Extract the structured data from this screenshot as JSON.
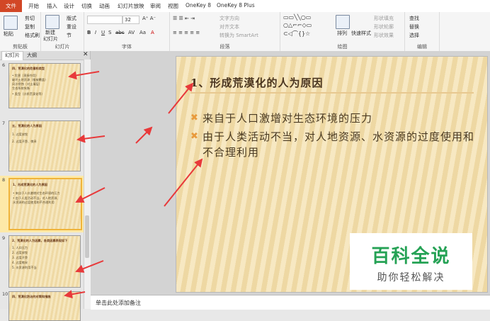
{
  "ribbon_tabs": [
    "文件",
    "开始",
    "插入",
    "设计",
    "切换",
    "动画",
    "幻灯片放映",
    "审阅",
    "视图",
    "OneKey 8",
    "OneKey 8 Plus"
  ],
  "clipboard": {
    "paste": "粘贴",
    "cut": "剪切",
    "copy": "复制",
    "format_painter": "格式刷",
    "label": "剪贴板"
  },
  "slides_group": {
    "new_slide": "新建",
    "new_slide2": "幻灯片",
    "layout": "版式",
    "reset": "重设",
    "section": "节",
    "label": "幻灯片"
  },
  "font_group": {
    "size": "32",
    "label": "字体"
  },
  "paragraph_group": {
    "text_direction": "文字方向",
    "align_text": "对齐文本",
    "convert_smartart": "转换为 SmartArt",
    "label": "段落"
  },
  "drawing_group": {
    "arrange": "排列",
    "quick_styles": "快速样式",
    "shape_fill": "形状填充",
    "shape_outline": "形状轮廓",
    "shape_effects": "形状效果",
    "label": "绘图"
  },
  "editing_group": {
    "find": "查找",
    "replace": "替换",
    "select": "选择",
    "label": "编辑"
  },
  "pane_tabs": {
    "slides": "幻灯片",
    "outline": "大纲"
  },
  "thumbnails": [
    {
      "num": "6",
      "lines": [
        "四、荒漠化的危害和类型",
        "• 危害（直接作用）",
        "  破坏土地资源（植被覆盖）",
        "  风沙侵蚀（对土壤层）",
        "  生态系统失衡",
        "• 类型（沙质荒漠化等）"
      ]
    },
    {
      "num": "7",
      "lines": [
        "五、荒漠化的人为原因",
        "1. 过度放牧",
        "2. 过度开垦、樵采"
      ]
    },
    {
      "num": "8",
      "lines": [
        "1、形成荒漠化的人为原因",
        "• 来自于人口激增对生态环境的压力",
        "• 由于人类活动不当，对人地资源、",
        "  水资源的过度使用和不合理利用"
      ]
    },
    {
      "num": "9",
      "lines": [
        "2、荒漠化的人为因素，各类因素表现如下",
        "1. 人口压力",
        "2. 过度放牧",
        "3. 过度开垦",
        "4. 过度樵采",
        "5. 水资源利用不当"
      ]
    },
    {
      "num": "10",
      "lines": [
        "四、荒漠化防治的对策和措施"
      ]
    }
  ],
  "slide": {
    "title": "1、形成荒漠化的人为原因",
    "bullets": [
      "来自于人口激增对生态环境的压力",
      "由于人类活动不当，对人地资源、水资源的过度使用和不合理利用"
    ]
  },
  "watermark": {
    "big": "百科全说",
    "small": "助你轻松解决"
  },
  "notes": {
    "placeholder": "单击此处添加备注"
  },
  "colors": {
    "file_tab": "#d24726",
    "arrow": "#e8393a",
    "bullet": "#e89a3c",
    "selected_thumb": "#f0b43a"
  }
}
